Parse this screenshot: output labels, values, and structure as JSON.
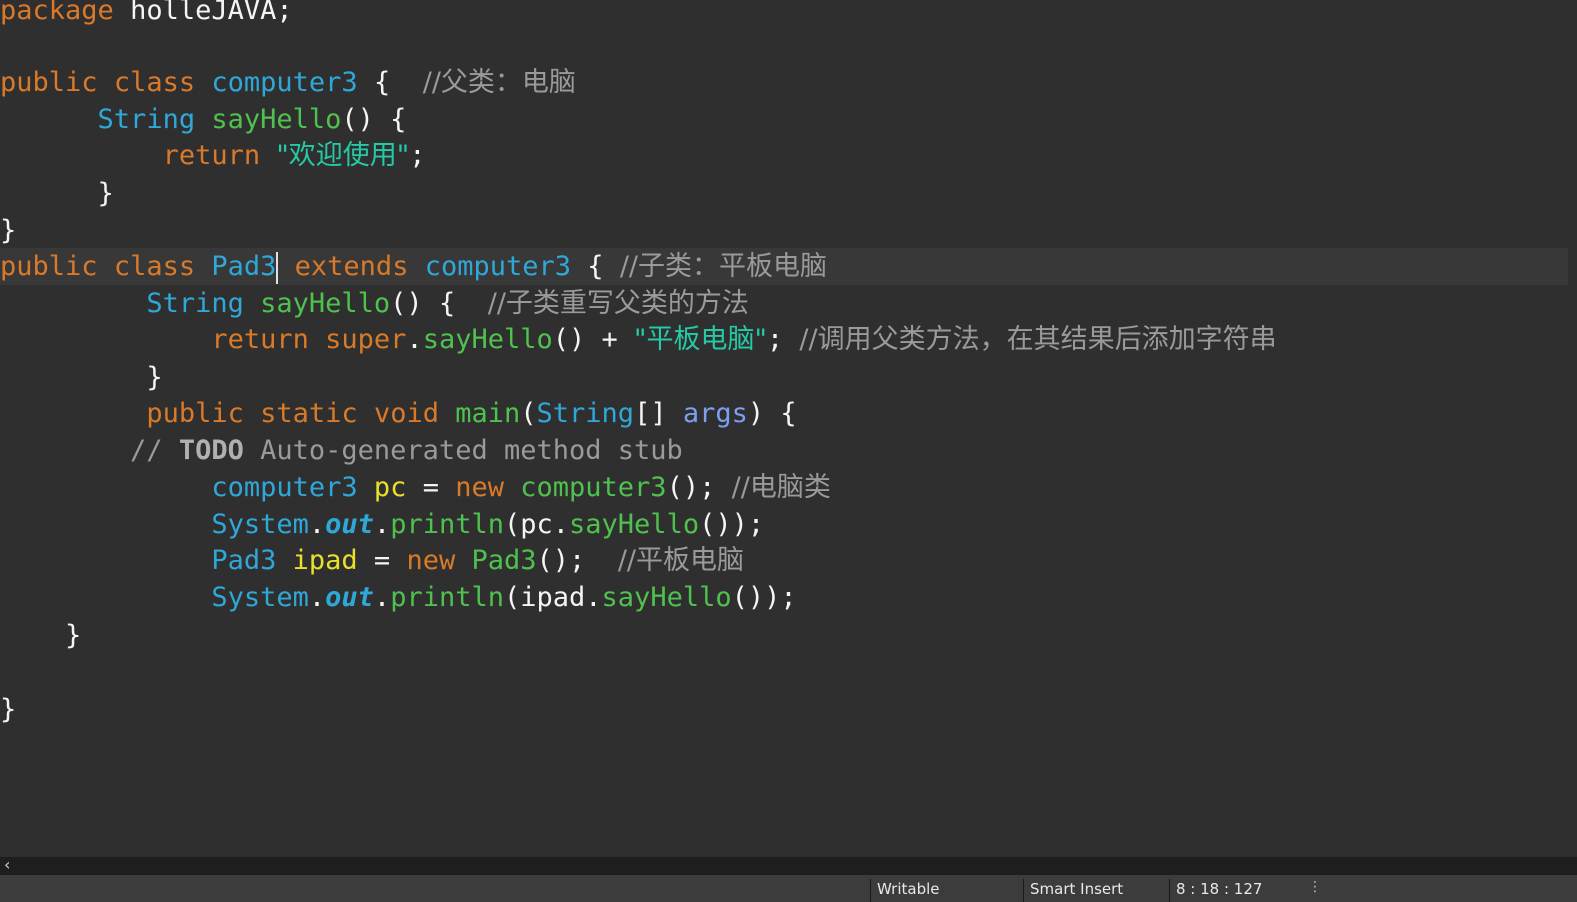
{
  "code": {
    "l1": {
      "kw": "package",
      "name": "holleJAVA;"
    },
    "l2": {
      "kw1": "public",
      "kw2": "class",
      "cls": "computer3",
      "brace": "{",
      "comment": "//父类：电脑"
    },
    "l3": {
      "type": "String",
      "method": "sayHello",
      "rest": "() {"
    },
    "l4": {
      "kw": "return",
      "str": "\"欢迎使用\"",
      "rest": ";"
    },
    "l5": {
      "brace": "}"
    },
    "l6": {
      "brace": "}"
    },
    "l7": {
      "kw1": "public",
      "kw2": "class",
      "cls": "Pad3",
      "kw3": "extends",
      "parent": "computer3",
      "brace": "{",
      "comment": "//子类：平板电脑"
    },
    "l8": {
      "type": "String",
      "method": "sayHello",
      "rest": "() {",
      "comment": "//子类重写父类的方法"
    },
    "l9": {
      "kw": "return",
      "sup": "super",
      "dot": ".",
      "method": "sayHello",
      "mid": "() +",
      "str": "\"平板电脑\"",
      "semi": ";",
      "comment": "//调用父类方法，在其结果后添加字符串"
    },
    "l10": {
      "brace": "}"
    },
    "l11": {
      "kw1": "public",
      "kw2": "static",
      "kw3": "void",
      "method": "main",
      "open": "(",
      "type": "String",
      "arr": "[]",
      "param": "args",
      "close": ") {"
    },
    "l12": {
      "slashes": "//",
      "todo": "TODO",
      "rest": "Auto-generated method stub"
    },
    "l13": {
      "type": "computer3",
      "var": "pc",
      "eq": "=",
      "kw": "new",
      "ctor": "computer3",
      "rest": "();",
      "comment": "//电脑类"
    },
    "l14": {
      "cls": "System",
      "dot1": ".",
      "field": "out",
      "dot2": ".",
      "method": "println",
      "open": "(",
      "var": "pc",
      "dot3": ".",
      "call": "sayHello",
      "close": "());"
    },
    "l15": {
      "type": "Pad3",
      "var": "ipad",
      "eq": "=",
      "kw": "new",
      "ctor": "Pad3",
      "rest": "();",
      "comment": "//平板电脑"
    },
    "l16": {
      "cls": "System",
      "dot1": ".",
      "field": "out",
      "dot2": ".",
      "method": "println",
      "open": "(",
      "var": "ipad",
      "dot3": ".",
      "call": "sayHello",
      "close": "());"
    },
    "l17": {
      "brace": "}"
    },
    "l18": {
      "brace": "}"
    }
  },
  "statusbar": {
    "mode": "Writable",
    "insert": "Smart Insert",
    "position": "8 : 18 : 127",
    "grip": "⋮"
  },
  "scrollbar": {
    "arrow": "‹"
  },
  "colors": {
    "background": "#2f2f2f",
    "keyword": "#d97a2a",
    "type": "#2fa8d8",
    "method": "#4fc14f",
    "string": "#26c9a6",
    "comment": "#9a9a9a",
    "variable": "#e8e02a",
    "parameter": "#7f9ef0"
  }
}
